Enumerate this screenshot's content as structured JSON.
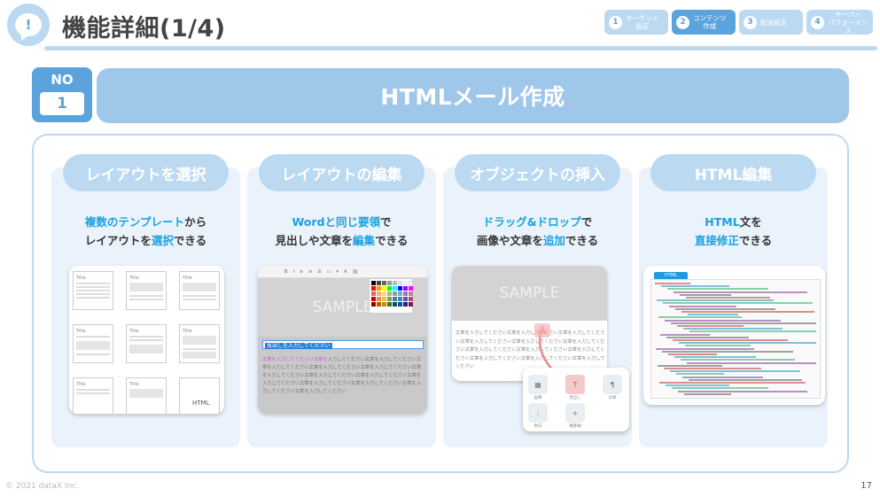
{
  "header": {
    "title": "機能詳細(1/4)",
    "logo_glyph": "!",
    "steps": [
      {
        "num": "1",
        "label": "ターゲット\n設定",
        "active": false
      },
      {
        "num": "2",
        "label": "コンテンツ\n作成",
        "active": true
      },
      {
        "num": "3",
        "label": "配信設定",
        "active": false
      },
      {
        "num": "4",
        "label": "サーバー\nパフォーマンス",
        "active": false
      }
    ]
  },
  "section": {
    "no_label": "NO",
    "no_value": "1",
    "banner": "HTMLメール作成"
  },
  "cards": [
    {
      "heading": "レイアウトを選択",
      "desc_line1": [
        {
          "t": "複数のテンプレート",
          "hl": true
        },
        {
          "t": "から",
          "hl": false
        }
      ],
      "desc_line2": [
        {
          "t": "レイアウトを",
          "hl": false
        },
        {
          "t": "選択",
          "hl": true
        },
        {
          "t": "できる",
          "hl": false
        }
      ],
      "template_title": "Title",
      "template_html": "HTML"
    },
    {
      "heading": "レイアウトの編集",
      "desc_line1": [
        {
          "t": "Wordと同じ要領",
          "hl": true
        },
        {
          "t": "で",
          "hl": false
        }
      ],
      "desc_line2": [
        {
          "t": "見出しや文章を",
          "hl": false
        },
        {
          "t": "編集",
          "hl": true
        },
        {
          "t": "できる",
          "hl": false
        }
      ],
      "sample": "SAMPLE",
      "selected_text": "見出しを入力してください",
      "body_text_pink": "文章を入力してください文章を",
      "body_text": "入力してください文章を入力してください文章を入力してください文章を入力してください文章を入力してください文章を入力してください文章を入力してください文章を入力してください文章を入力してください文章を入力してください文章を入力してください文章を入力してください文章を入力してください"
    },
    {
      "heading": "オブジェクトの挿入",
      "desc_line1": [
        {
          "t": "ドラッグ&ドロップ",
          "hl": true
        },
        {
          "t": "で",
          "hl": false
        }
      ],
      "desc_line2": [
        {
          "t": "画像や文章を",
          "hl": false
        },
        {
          "t": "追加",
          "hl": true
        },
        {
          "t": "できる",
          "hl": false
        }
      ],
      "sample": "SAMPLE",
      "body_text": "文章を入力してください文章を入力してください文章を入力してください文章を入力してください文章を入力してください文章を入力してください文章を入力してください文章を入力してください文章を入力してください文章を入力してください文章を入力してください文章を入力してください",
      "panel_labels": [
        "画像",
        "見出し",
        "文章",
        "余白",
        "横罫線"
      ]
    },
    {
      "heading": "HTML編集",
      "desc_line1": [
        {
          "t": "HTML",
          "hl": true
        },
        {
          "t": "文を",
          "hl": false
        }
      ],
      "desc_line2": [
        {
          "t": "直接修正",
          "hl": true
        },
        {
          "t": "できる",
          "hl": false
        }
      ],
      "code_tab": "HTML"
    }
  ],
  "footer": {
    "copyright": "© 2021 dataX Inc.",
    "page": "17"
  },
  "colors": {
    "accent": "#5aa3dc",
    "light": "#bcd9f2",
    "highlight": "#1aa0e0"
  }
}
